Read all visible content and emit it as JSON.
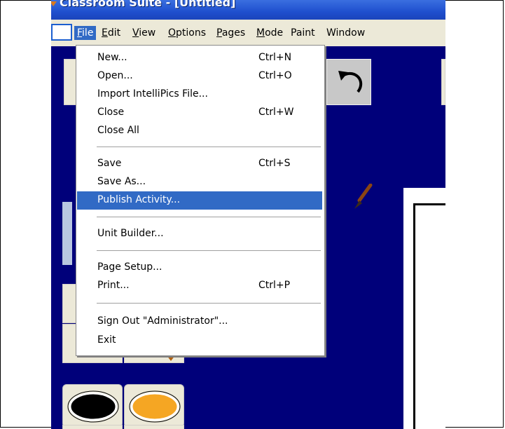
{
  "window": {
    "title": "Classroom Suite - [Untitled]"
  },
  "menubar": {
    "items": [
      {
        "label": "File",
        "active": true
      },
      {
        "label": "Edit"
      },
      {
        "label": "View"
      },
      {
        "label": "Options"
      },
      {
        "label": "Pages"
      },
      {
        "label": "Mode"
      },
      {
        "label": "Paint"
      },
      {
        "label": "Window"
      }
    ]
  },
  "file_menu": {
    "groups": [
      [
        {
          "label": "New...",
          "shortcut": "Ctrl+N"
        },
        {
          "label": "Open...",
          "shortcut": "Ctrl+O"
        },
        {
          "label": "Import IntelliPics File...",
          "shortcut": ""
        },
        {
          "label": "Close",
          "shortcut": "Ctrl+W"
        },
        {
          "label": "Close All",
          "shortcut": ""
        }
      ],
      [
        {
          "label": "Save",
          "shortcut": "Ctrl+S"
        },
        {
          "label": "Save As...",
          "shortcut": ""
        },
        {
          "label": "Publish Activity...",
          "shortcut": "",
          "highlighted": true
        }
      ],
      [
        {
          "label": "Unit Builder...",
          "shortcut": ""
        }
      ],
      [
        {
          "label": "Page Setup...",
          "shortcut": ""
        },
        {
          "label": "Print...",
          "shortcut": "Ctrl+P"
        }
      ],
      [
        {
          "label": "Sign Out \"Administrator\"...",
          "shortcut": ""
        },
        {
          "label": "Exit",
          "shortcut": ""
        }
      ]
    ]
  },
  "toolbar": {
    "undo_icon": "undo-icon"
  },
  "palette": {
    "colors": [
      {
        "name": "black-swatch",
        "hex": "#000000"
      },
      {
        "name": "orange-swatch",
        "hex": "#f5a623"
      }
    ]
  },
  "theme": {
    "workspace_bg": "#00007a",
    "menu_highlight": "#316ac5",
    "titlebar": "#1f4fce",
    "menubar_bg": "#ece9d8"
  }
}
